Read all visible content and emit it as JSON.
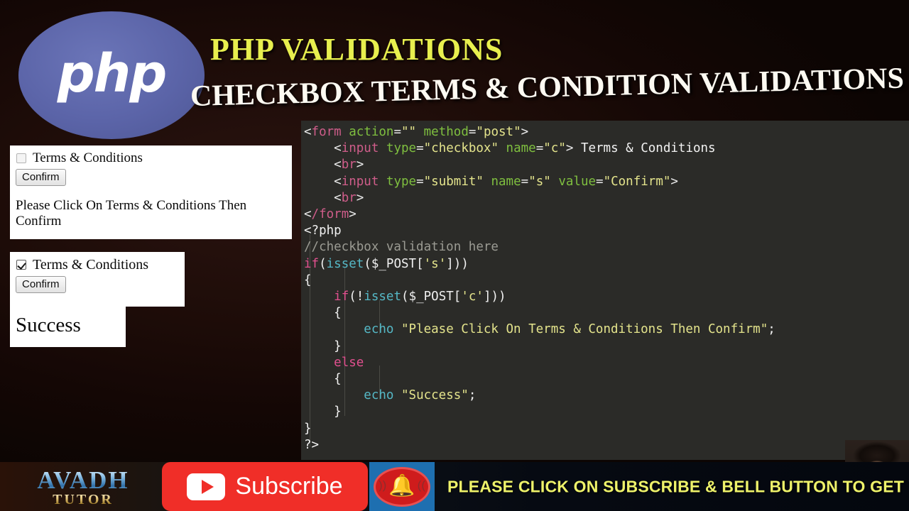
{
  "logo": {
    "wordmark": "php",
    "alt": "php-elephant-logo"
  },
  "titles": {
    "main": "PHP VALIDATIONS",
    "sub": "CHECKBOX TERMS & CONDITION VALIDATIONS",
    "main_color": "#e8ef4e",
    "sub_color": "#fdfaf2"
  },
  "outputs": {
    "panel1": {
      "checkbox_checked": false,
      "checkbox_label": "Terms & Conditions",
      "button_label": "Confirm",
      "message": "Please Click On Terms & Conditions Then Confirm"
    },
    "panel2": {
      "checkbox_checked": true,
      "checkbox_label": "Terms & Conditions",
      "button_label": "Confirm"
    },
    "panel3": {
      "message": "Success"
    }
  },
  "code": {
    "background": "#2b2b28",
    "lines": [
      "<form action=\"\" method=\"post\">",
      "    <input type=\"checkbox\" name=\"c\"> Terms & Conditions",
      "    <br>",
      "    <input type=\"submit\" name=\"s\" value=\"Confirm\">",
      "    <br>",
      "</form>",
      "<?php",
      "//checkbox validation here",
      "if(isset($_POST['s']))",
      "{",
      "    if(!isset($_POST['c']))",
      "    {",
      "        echo \"Please Click On Terms & Conditions Then Confirm\";",
      "    }",
      "    else",
      "    {",
      "        echo \"Success\";",
      "    }",
      "}",
      "?>"
    ],
    "colors": {
      "tag": "#cf5d8a",
      "attribute": "#7fbf3f",
      "string": "#e4e48c",
      "comment": "#9b9b93",
      "keyword": "#e2508f",
      "function": "#55b8c6",
      "plain": "#f2f2f2"
    }
  },
  "webcam": {
    "label": "presenter-webcam"
  },
  "bottom_bar": {
    "brand_top": "AVADH",
    "brand_bottom": "TUTOR",
    "subscribe_label": "Subscribe",
    "bell_icon": "bell-icon",
    "cta": "PLEASE CLICK ON SUBSCRIBE & BELL BUTTON TO GET VIDEOS DAILY",
    "cta_color": "#eef26a",
    "subscribe_color": "#f02e28",
    "bell_bg_color": "#1e6fb0"
  }
}
